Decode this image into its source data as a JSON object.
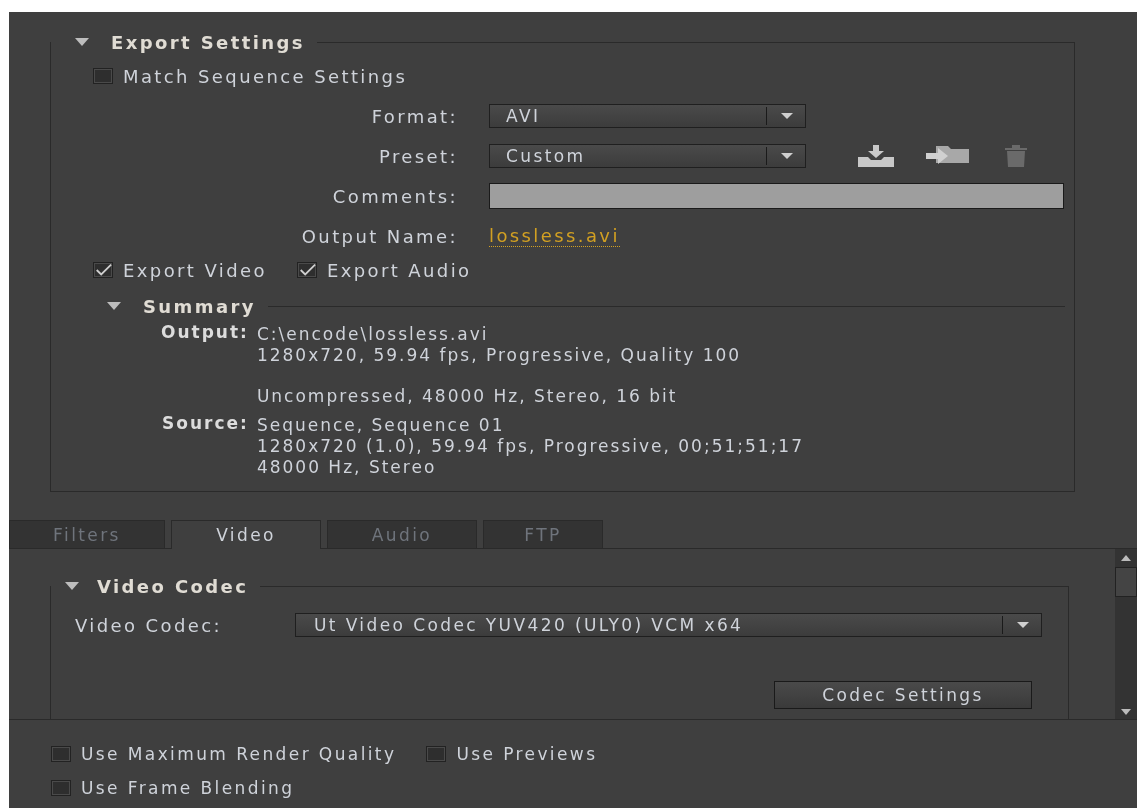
{
  "export_settings": {
    "title": "Export Settings",
    "match_sequence": {
      "label": "Match Sequence Settings",
      "checked": false
    },
    "format": {
      "label": "Format:",
      "value": "AVI"
    },
    "preset": {
      "label": "Preset:",
      "value": "Custom"
    },
    "comments": {
      "label": "Comments:"
    },
    "output_name": {
      "label": "Output Name:",
      "value": "lossless.avi"
    },
    "export_video": {
      "label": "Export Video",
      "checked": true
    },
    "export_audio": {
      "label": "Export Audio",
      "checked": true
    },
    "summary": {
      "title": "Summary",
      "items": [
        {
          "label": "Output:",
          "blocks": [
            [
              "C:\\encode\\lossless.avi",
              "1280x720, 59.94 fps, Progressive, Quality 100"
            ],
            [
              "Uncompressed, 48000 Hz, Stereo, 16 bit"
            ]
          ]
        },
        {
          "label": "Source:",
          "blocks": [
            [
              "Sequence, Sequence 01",
              "1280x720 (1.0), 59.94 fps, Progressive, 00;51;51;17",
              "48000 Hz, Stereo"
            ]
          ]
        }
      ]
    }
  },
  "tabs": [
    {
      "label": "Filters",
      "selected": false
    },
    {
      "label": "Video",
      "selected": true
    },
    {
      "label": "Audio",
      "selected": false
    },
    {
      "label": "FTP",
      "selected": false
    }
  ],
  "video_codec": {
    "title": "Video Codec",
    "label": "Video Codec:",
    "value": "Ut Video Codec YUV420 (ULY0) VCM x64",
    "button": "Codec Settings"
  },
  "options": [
    {
      "label": "Use Maximum Render Quality",
      "checked": false
    },
    {
      "label": "Use Previews",
      "checked": false
    },
    {
      "label": "Use Frame Blending",
      "checked": false
    }
  ]
}
